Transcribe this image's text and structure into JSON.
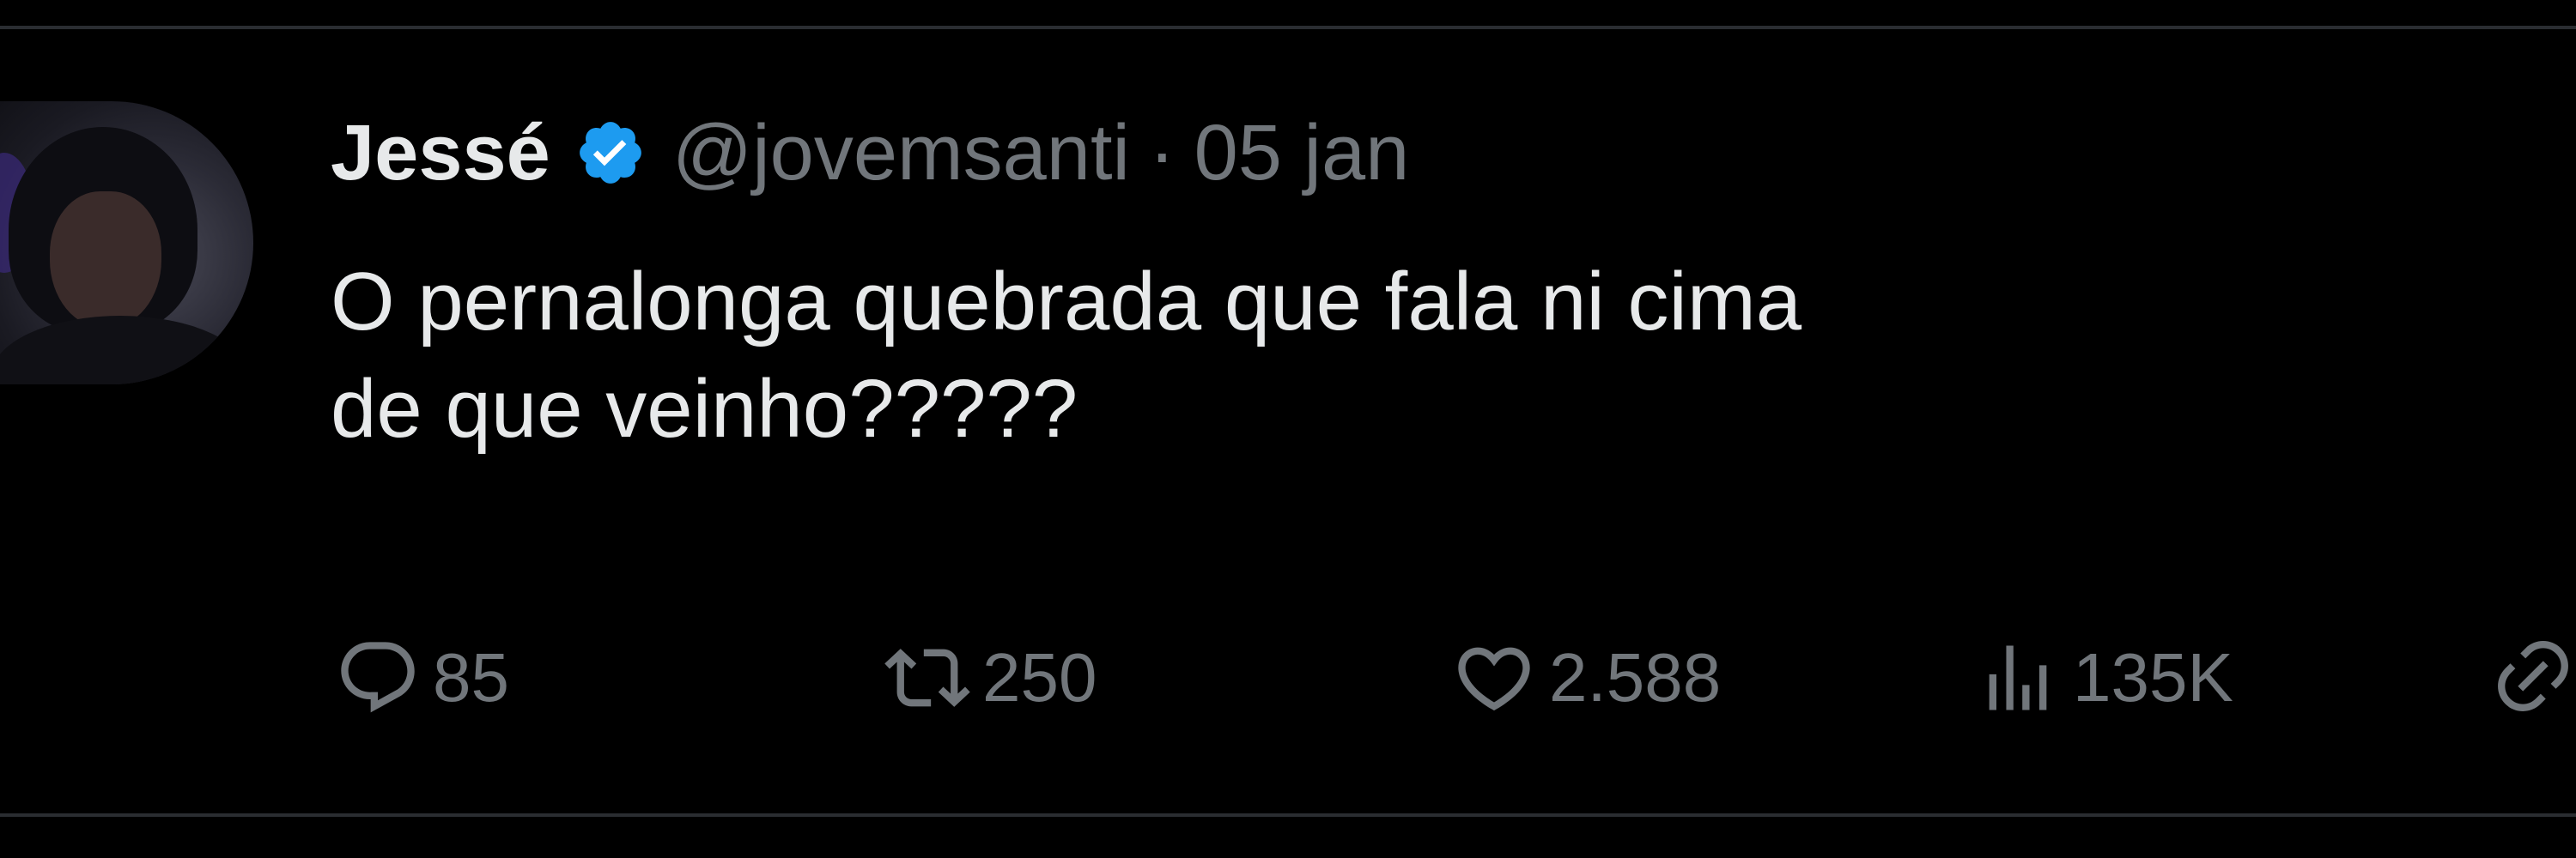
{
  "tweet": {
    "author_name": "Jessé",
    "handle": "@jovemsanti",
    "separator": "·",
    "date": "05 jan",
    "text": "O pernalonga quebrada que fala ni cima\nde que veinho?????"
  },
  "actions": {
    "replies": "85",
    "retweets": "250",
    "likes": "2.588",
    "views": "135K"
  },
  "colors": {
    "background": "#000000",
    "primary_text": "#e7e9ea",
    "secondary_text": "#71767b",
    "verified_badge": "#1d9bf0"
  },
  "icons": {
    "verified": "verified-badge-icon",
    "reply": "speech-bubble-icon",
    "retweet": "retweet-arrows-icon",
    "like": "heart-icon",
    "views": "bar-chart-icon",
    "share": "share-icon"
  }
}
